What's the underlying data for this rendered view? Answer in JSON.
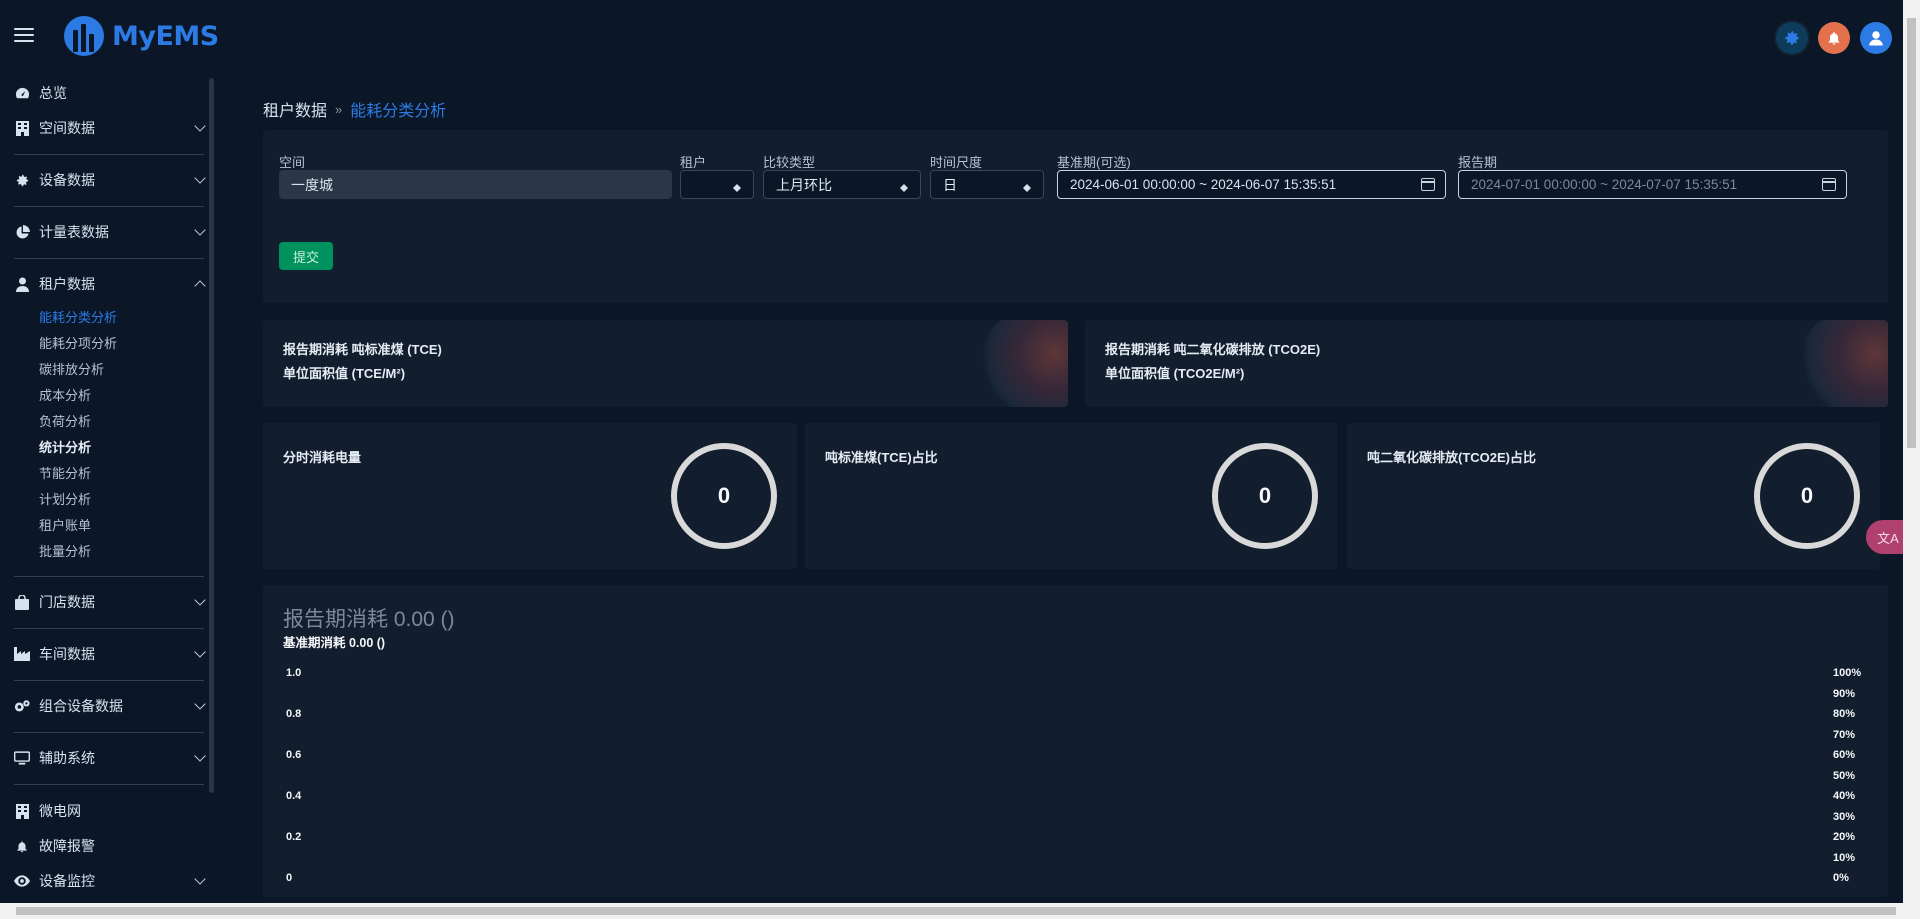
{
  "app": {
    "logo_text": "MyEMS",
    "brand_color": "#2c7be5"
  },
  "sidebar": {
    "items": [
      {
        "label": "总览",
        "icon": "speedometer-icon"
      },
      {
        "label": "空间数据",
        "icon": "building-icon"
      },
      {
        "label": "设备数据",
        "icon": "gear-icon"
      },
      {
        "label": "计量表数据",
        "icon": "pie-chart-icon"
      },
      {
        "label": "租户数据",
        "icon": "user-icon"
      },
      {
        "label": "门店数据",
        "icon": "shopping-bag-icon"
      },
      {
        "label": "车间数据",
        "icon": "industry-icon"
      },
      {
        "label": "组合设备数据",
        "icon": "gears-icon"
      },
      {
        "label": "辅助系统",
        "icon": "monitor-icon"
      },
      {
        "label": "微电网",
        "icon": "building-icon"
      },
      {
        "label": "故障报警",
        "icon": "bell-icon"
      },
      {
        "label": "设备监控",
        "icon": "eye-icon"
      }
    ],
    "tenant_sub_items": [
      "能耗分类分析",
      "能耗分项分析",
      "碳排放分析",
      "成本分析",
      "负荷分析",
      "统计分析",
      "节能分析",
      "计划分析",
      "租户账单",
      "批量分析"
    ]
  },
  "breadcrumb": {
    "parent": "租户数据",
    "separator": "»",
    "current": "能耗分类分析"
  },
  "filters": {
    "space_label": "空间",
    "space_value": "一度城",
    "tenant_label": "租户",
    "tenant_value": "",
    "compare_label": "比较类型",
    "compare_value": "上月环比",
    "period_label": "时间尺度",
    "period_value": "日",
    "base_label": "基准期(可选)",
    "base_value": "2024-06-01 00:00:00 ~ 2024-06-07 15:35:51",
    "report_label": "报告期",
    "report_value": "2024-07-01 00:00:00 ~ 2024-07-07 15:35:51",
    "submit_label": "提交"
  },
  "stat_cards": [
    {
      "line1": "报告期消耗 吨标准煤 (TCE)",
      "line2": "单位面积值 (TCE/M²)"
    },
    {
      "line1": "报告期消耗 吨二氧化碳排放 (TCO2E)",
      "line2": "单位面积值 (TCO2E/M²)"
    }
  ],
  "gauges": [
    {
      "title": "分时消耗电量",
      "value": "0"
    },
    {
      "title": "吨标准煤(TCE)占比",
      "value": "0"
    },
    {
      "title": "吨二氧化碳排放(TCO2E)占比",
      "value": "0"
    }
  ],
  "chart": {
    "title": "报告期消耗 0.00 ()",
    "subtitle": "基准期消耗 0.00 ()",
    "y_left_ticks": [
      "1.0",
      "0.8",
      "0.6",
      "0.4",
      "0.2",
      "0"
    ],
    "y_right_ticks": [
      "100%",
      "90%",
      "80%",
      "70%",
      "60%",
      "50%",
      "40%",
      "30%",
      "20%",
      "10%",
      "0%"
    ]
  },
  "float_badge": {
    "label": "文A",
    "icon": "translate-icon"
  }
}
